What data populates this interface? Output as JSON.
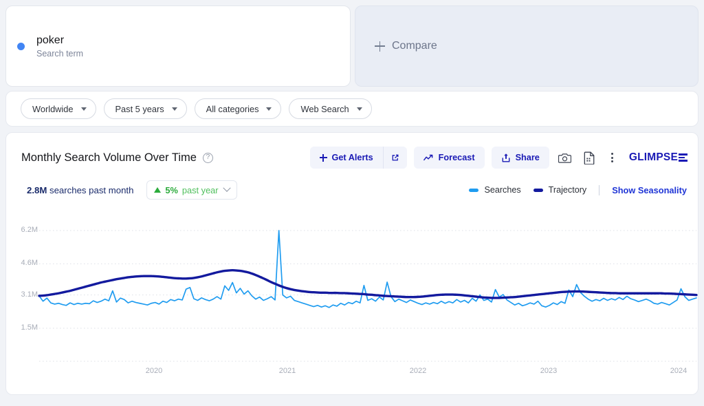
{
  "term": {
    "name": "poker",
    "subtitle": "Search term",
    "dot_color": "#4285f4"
  },
  "compare": {
    "label": "Compare",
    "icon": "plus-icon"
  },
  "filters": [
    {
      "label": "Worldwide"
    },
    {
      "label": "Past 5 years"
    },
    {
      "label": "All categories"
    },
    {
      "label": "Web Search"
    }
  ],
  "chart_card": {
    "title": "Monthly Search Volume Over Time",
    "help_icon": "?",
    "buttons": {
      "get_alerts": "Get Alerts",
      "external_link_icon": "external-link-icon",
      "forecast": "Forecast",
      "share": "Share"
    },
    "icons": {
      "camera": "camera-icon",
      "report": "report-icon",
      "kebab": "more-options-icon"
    },
    "logo": "GLIMPSE"
  },
  "stats": {
    "value": "2.8M",
    "value_suffix": " searches past month",
    "delta_pct": "5%",
    "delta_period": " past year",
    "delta_direction": "up",
    "delta_color": "#2cab3c"
  },
  "legend": {
    "searches": "Searches",
    "trajectory": "Trajectory",
    "seasonality_link": "Show Seasonality",
    "searches_color": "#1f9cf0",
    "trajectory_color": "#131a9e"
  },
  "chart_data": {
    "type": "line",
    "title": "Monthly Search Volume Over Time",
    "xlabel": "",
    "ylabel": "",
    "ylim": [
      1500000,
      6200000
    ],
    "ytick_labels": [
      "6.2M",
      "4.6M",
      "3.1M",
      "1.5M"
    ],
    "ytick_values": [
      6200000,
      4600000,
      3100000,
      1500000
    ],
    "xtick_labels": [
      "2020",
      "2021",
      "2022",
      "2023",
      "2024"
    ],
    "grid": true,
    "legend_position": "top-right",
    "series": [
      {
        "name": "Searches",
        "color": "#1f9cf0",
        "values": [
          3.05,
          2.8,
          2.95,
          2.72,
          2.66,
          2.7,
          2.64,
          2.6,
          2.72,
          2.64,
          2.7,
          2.66,
          2.7,
          2.68,
          2.82,
          2.74,
          2.8,
          2.9,
          2.82,
          3.3,
          2.76,
          2.95,
          2.88,
          2.72,
          2.8,
          2.74,
          2.7,
          2.66,
          2.62,
          2.7,
          2.74,
          2.66,
          2.8,
          2.74,
          2.88,
          2.82,
          2.9,
          2.86,
          3.38,
          3.46,
          2.92,
          2.84,
          2.96,
          2.88,
          2.82,
          2.9,
          3.02,
          2.9,
          3.54,
          3.32,
          3.7,
          3.2,
          3.42,
          3.14,
          3.3,
          3.06,
          2.9,
          3.0,
          2.84,
          2.92,
          3.02,
          2.86,
          6.2,
          3.1,
          2.96,
          3.04,
          2.84,
          2.78,
          2.72,
          2.66,
          2.6,
          2.54,
          2.6,
          2.52,
          2.58,
          2.5,
          2.62,
          2.56,
          2.7,
          2.62,
          2.74,
          2.68,
          2.8,
          2.72,
          3.56,
          2.84,
          2.92,
          2.8,
          3.0,
          2.86,
          3.72,
          3.02,
          2.78,
          2.9,
          2.82,
          2.74,
          2.86,
          2.78,
          2.7,
          2.64,
          2.72,
          2.66,
          2.74,
          2.68,
          2.8,
          2.7,
          2.78,
          2.72,
          2.88,
          2.76,
          2.84,
          2.72,
          2.94,
          2.8,
          3.1,
          2.84,
          2.9,
          2.76,
          3.36,
          3.0,
          3.12,
          2.86,
          2.74,
          2.62,
          2.7,
          2.58,
          2.64,
          2.72,
          2.66,
          2.8,
          2.58,
          2.52,
          2.6,
          2.72,
          2.64,
          2.78,
          2.7,
          3.34,
          3.02,
          3.6,
          3.22,
          3.04,
          2.9,
          2.8,
          2.88,
          2.82,
          2.94,
          2.84,
          2.92,
          2.86,
          2.98,
          2.88,
          3.04,
          2.92,
          2.86,
          2.78,
          2.84,
          2.9,
          2.82,
          2.7,
          2.66,
          2.74,
          2.68,
          2.62,
          2.74,
          2.86,
          3.4,
          3.02,
          2.84,
          2.9,
          2.96
        ]
      },
      {
        "name": "Trajectory",
        "color": "#131a9e",
        "values": [
          3.06,
          3.07,
          3.09,
          3.12,
          3.15,
          3.18,
          3.22,
          3.26,
          3.3,
          3.35,
          3.4,
          3.45,
          3.5,
          3.55,
          3.6,
          3.65,
          3.7,
          3.74,
          3.78,
          3.82,
          3.86,
          3.89,
          3.92,
          3.95,
          3.97,
          3.99,
          4.0,
          4.01,
          4.01,
          4.01,
          4.0,
          3.99,
          3.97,
          3.95,
          3.93,
          3.91,
          3.9,
          3.89,
          3.89,
          3.9,
          3.92,
          3.95,
          3.99,
          4.04,
          4.09,
          4.14,
          4.19,
          4.23,
          4.26,
          4.28,
          4.29,
          4.28,
          4.26,
          4.23,
          4.19,
          4.13,
          4.06,
          3.98,
          3.9,
          3.81,
          3.72,
          3.64,
          3.56,
          3.49,
          3.43,
          3.38,
          3.34,
          3.31,
          3.28,
          3.26,
          3.24,
          3.23,
          3.22,
          3.21,
          3.21,
          3.2,
          3.2,
          3.2,
          3.19,
          3.19,
          3.18,
          3.17,
          3.16,
          3.15,
          3.14,
          3.12,
          3.11,
          3.09,
          3.08,
          3.06,
          3.05,
          3.04,
          3.03,
          3.02,
          3.01,
          3.0,
          3.0,
          3.0,
          3.01,
          3.02,
          3.04,
          3.06,
          3.08,
          3.1,
          3.11,
          3.12,
          3.12,
          3.12,
          3.11,
          3.1,
          3.08,
          3.06,
          3.04,
          3.02,
          3.0,
          2.98,
          2.97,
          2.96,
          2.96,
          2.96,
          2.97,
          2.98,
          2.99,
          3.0,
          3.02,
          3.04,
          3.06,
          3.08,
          3.1,
          3.12,
          3.14,
          3.16,
          3.18,
          3.2,
          3.22,
          3.24,
          3.25,
          3.26,
          3.27,
          3.27,
          3.27,
          3.26,
          3.25,
          3.24,
          3.23,
          3.22,
          3.21,
          3.2,
          3.19,
          3.19,
          3.18,
          3.18,
          3.18,
          3.18,
          3.18,
          3.18,
          3.18,
          3.18,
          3.18,
          3.18,
          3.18,
          3.18,
          3.17,
          3.17,
          3.16,
          3.15,
          3.14,
          3.13,
          3.12,
          3.11,
          3.1
        ]
      }
    ]
  }
}
